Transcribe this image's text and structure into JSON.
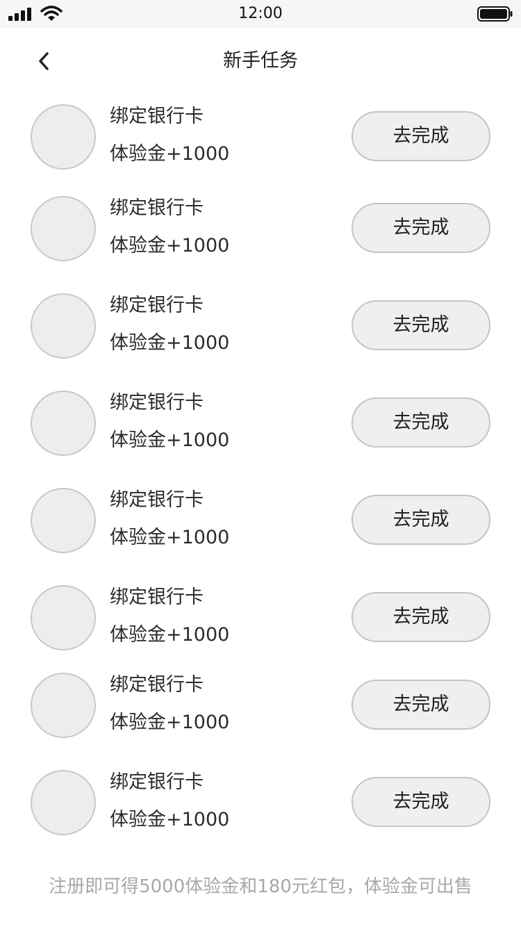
{
  "status_bar": {
    "time": "12:00",
    "signal_icon": "signal-bars-icon",
    "wifi_icon": "wifi-icon",
    "battery_icon": "battery-full-icon"
  },
  "nav": {
    "back_icon": "chevron-left-icon",
    "title": "新手任务"
  },
  "tasks": [
    {
      "name": "绑定银行卡",
      "reward": "体验金+1000",
      "action": "去完成"
    },
    {
      "name": "绑定银行卡",
      "reward": "体验金+1000",
      "action": "去完成"
    },
    {
      "name": "绑定银行卡",
      "reward": "体验金+1000",
      "action": "去完成"
    },
    {
      "name": "绑定银行卡",
      "reward": "体验金+1000",
      "action": "去完成"
    },
    {
      "name": "绑定银行卡",
      "reward": "体验金+1000",
      "action": "去完成"
    },
    {
      "name": "绑定银行卡",
      "reward": "体验金+1000",
      "action": "去完成"
    },
    {
      "name": "绑定银行卡",
      "reward": "体验金+1000",
      "action": "去完成"
    },
    {
      "name": "绑定银行卡",
      "reward": "体验金+1000",
      "action": "去完成"
    }
  ],
  "footer": {
    "note": "注册即可得5000体验金和180元红包，体验金可出售"
  }
}
